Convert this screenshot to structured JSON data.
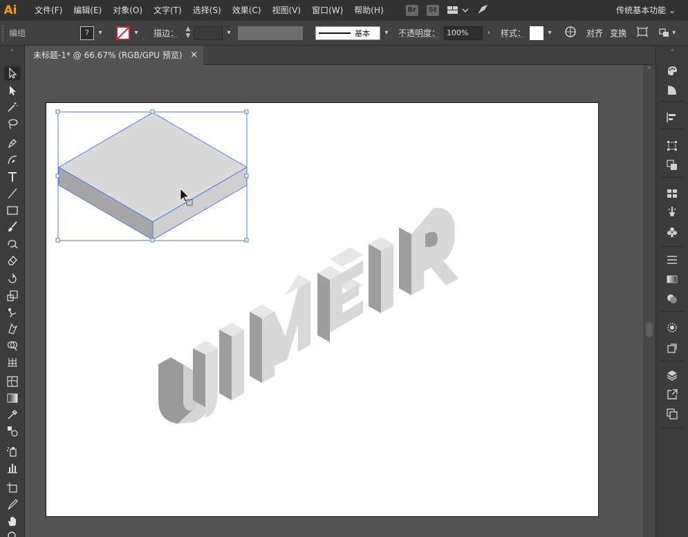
{
  "app": {
    "logo": "Ai",
    "menu": [
      "文件(F)",
      "编辑(E)",
      "对象(O)",
      "文字(T)",
      "选择(S)",
      "效果(C)",
      "视图(V)",
      "窗口(W)",
      "帮助(H)"
    ],
    "bridge_badge": "Br",
    "stock_badge": "St",
    "workspace": "传统基本功能"
  },
  "controlbar": {
    "selection_label": "编组",
    "fill_label": "?",
    "stroke_label": "描边：",
    "brush_label": "基本",
    "opacity_label": "不透明度：",
    "opacity_value": "100%",
    "style_label": "样式：",
    "align_label": "对齐",
    "transform_label": "变换"
  },
  "document": {
    "tab_title": "未标题-1* @ 66.67% (RGB/GPU 预览)",
    "close_glyph": "×"
  },
  "artwork": {
    "text_3d": "UIMEIR",
    "face_color": "#dcdcdc",
    "side_color": "#9a9a9a",
    "top_color": "#e6e6e6",
    "selection_color": "#4a7ce8"
  },
  "colors": {
    "menubar": "#323232",
    "panel": "#3c3c3c",
    "canvas": "#535353",
    "accent_logo": "#ff9a00"
  }
}
